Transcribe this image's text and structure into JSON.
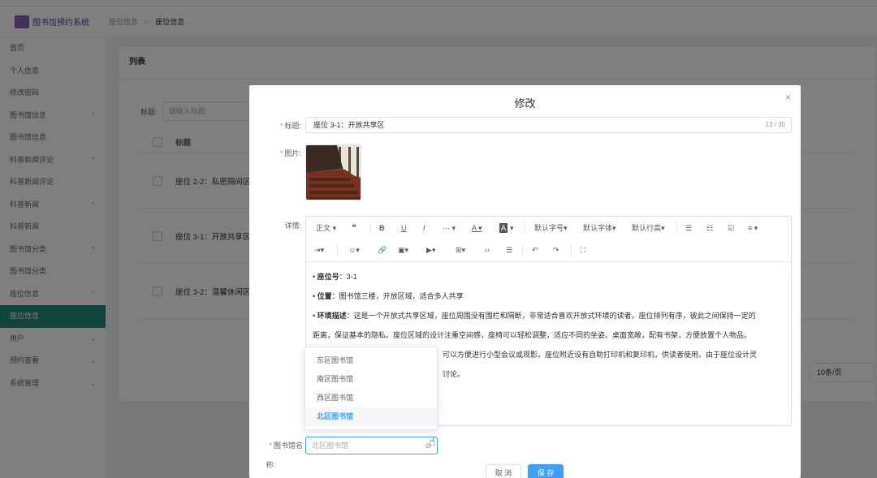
{
  "header": {
    "app_title": "图书馆预约系统",
    "breadcrumb": [
      "座位信息",
      "座位信息"
    ],
    "separator": ">"
  },
  "sidebar": {
    "items": [
      {
        "label": "首页",
        "arrow": ""
      },
      {
        "label": "个人信息",
        "arrow": ""
      },
      {
        "label": "修改密码",
        "arrow": ""
      },
      {
        "label": "图书馆信息",
        "arrow": "^"
      },
      {
        "label": "图书馆信息",
        "arrow": ""
      },
      {
        "label": "科普新闻评论",
        "arrow": "^"
      },
      {
        "label": "科普新闻评论",
        "arrow": ""
      },
      {
        "label": "科普新闻",
        "arrow": "^"
      },
      {
        "label": "科普新闻",
        "arrow": ""
      },
      {
        "label": "图书馆分类",
        "arrow": "^"
      },
      {
        "label": "图书馆分类",
        "arrow": ""
      },
      {
        "label": "座位信息",
        "arrow": "^"
      },
      {
        "label": "座位信息",
        "arrow": "",
        "active": true
      },
      {
        "label": "用户",
        "arrow": "v"
      },
      {
        "label": "预约查看",
        "arrow": "v"
      },
      {
        "label": "系统管理",
        "arrow": "v"
      }
    ]
  },
  "main": {
    "list_title": "列表",
    "filter": {
      "label": "标题:",
      "placeholder": "请输入标题"
    },
    "table": {
      "header": "标题",
      "rows": [
        "座位 2-2：私密隔间区",
        "座位 3-1：开放共享区",
        "座位 3-2：温馨休闲区"
      ]
    },
    "page_size": "10条/页"
  },
  "dialog": {
    "title": "修改",
    "close": "×",
    "fields": {
      "title_label": "标题:",
      "title_value": "座位 3-1：开放共享区",
      "title_count": "13 / 30",
      "image_label": "图片:",
      "detail_label": "详情:",
      "library_label_1": "图书馆名",
      "library_label_2": "称:",
      "library_placeholder": "北区图书馆"
    },
    "toolbar": {
      "row1": [
        "正文",
        "❝",
        "B",
        "U",
        "I",
        "···",
        "A",
        "A",
        "默认字号",
        "默认字体",
        "默认行高",
        "☰",
        "☷",
        "☑",
        "≡"
      ],
      "row2": [
        "⇥",
        "☺",
        "🔗",
        "▣",
        "▶",
        "⊞",
        "‹›",
        "☰",
        "↶",
        "↷",
        "⛶"
      ]
    },
    "content": {
      "line1_bold": "座位号",
      "line1_text": "：3-1",
      "line2_bold": "位置",
      "line2_text": "：图书馆三楼，开放区域，适合多人共享",
      "line3_bold": "环境描述",
      "line3_text": "：这是一个开放式共享区域，座位周围没有围栏和隔断，非常适合喜欢开放式环境的读者。座位排列有序，彼此之间保持一定的",
      "line4": "距离，保证基本的隐私。座位区域的设计注重空间感，座椅可以轻松调整，适应不同的坐姿。桌面宽敞，配有书架，方便放置个人物品。",
      "line5": "可以方便进行小型会议或观影。座位附近设有自助打印机和复印机，供读者使用。由于座位设计灵",
      "line6": "讨论。"
    },
    "dropdown": {
      "options": [
        "东区图书馆",
        "南区图书馆",
        "西区图书馆",
        "北区图书馆"
      ],
      "selected": "北区图书馆"
    },
    "buttons": {
      "cancel": "取 消",
      "save": "保 存"
    }
  }
}
